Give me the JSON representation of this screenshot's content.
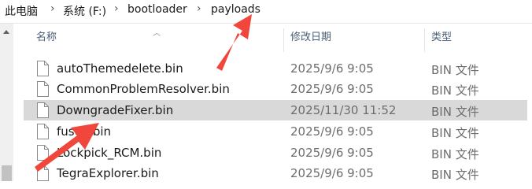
{
  "breadcrumb": {
    "items": [
      "此电脑",
      "系统 (F:)",
      "bootloader",
      "payloads"
    ]
  },
  "columns": {
    "name": "名称",
    "date": "修改日期",
    "type": "类型"
  },
  "files": [
    {
      "name": "autoThemedelete.bin",
      "date": "2025/9/6 9:05",
      "type": "BIN 文件",
      "selected": false
    },
    {
      "name": "CommonProblemResolver.bin",
      "date": "2025/9/6 9:05",
      "type": "BIN 文件",
      "selected": false
    },
    {
      "name": "DowngradeFixer.bin",
      "date": "2025/11/30 11:52",
      "type": "BIN 文件",
      "selected": true
    },
    {
      "name": "fusee.bin",
      "date": "2025/9/6 9:05",
      "type": "BIN 文件",
      "selected": false
    },
    {
      "name": "Lockpick_RCM.bin",
      "date": "2025/9/6 9:05",
      "type": "BIN 文件",
      "selected": false
    },
    {
      "name": "TegraExplorer.bin",
      "date": "2025/9/6 9:05",
      "type": "BIN 文件",
      "selected": false
    }
  ],
  "colors": {
    "selection": "#d9d9d9",
    "annotation_arrow": "#f0463c",
    "header_text": "#4a6078"
  },
  "icons": {
    "file": "file-icon",
    "separator": "chevron-right-icon",
    "scroll_up": "scroll-up-icon",
    "sort": "sort-up-icon"
  }
}
